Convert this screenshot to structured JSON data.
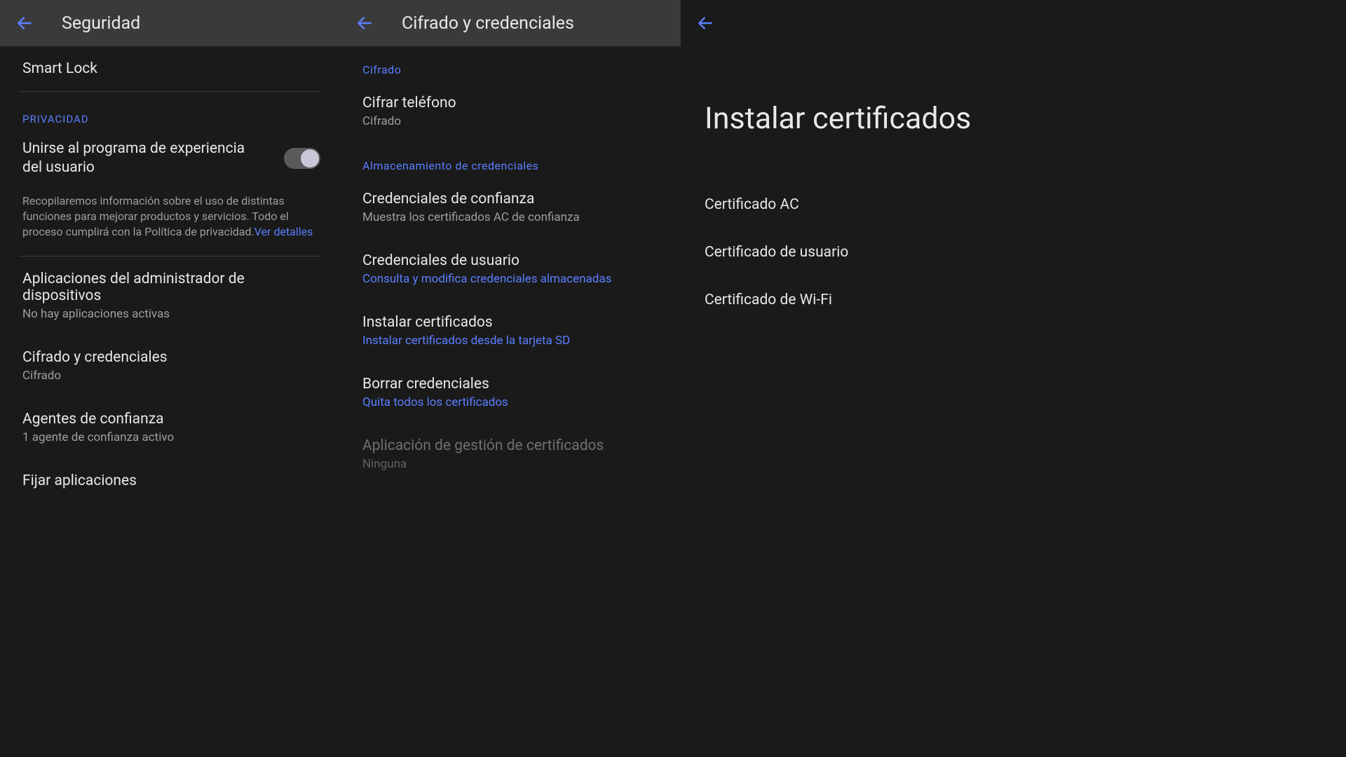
{
  "colors": {
    "accent": "#5a7fff",
    "bg": "#1a1a1a",
    "header_bg": "#3a3a3a"
  },
  "panel1": {
    "header_title": "Seguridad",
    "smart_lock": "Smart Lock",
    "privacy_header": "PRIVACIDAD",
    "ux_program_label": "Unirse al programa de experiencia del usuario",
    "ux_desc": "Recopilaremos información sobre el uso de distintas funciones para mejorar productos y servicios. Todo el proceso cumplirá con la Política de privacidad.",
    "ux_link": "Ver detalles",
    "admin_apps_title": "Aplicaciones del administrador de dispositivos",
    "admin_apps_sub": "No hay aplicaciones activas",
    "encrypt_creds_title": "Cifrado y credenciales",
    "encrypt_creds_sub": "Cifrado",
    "trust_agents_title": "Agentes de confianza",
    "trust_agents_sub": "1 agente de confianza activo",
    "pin_apps_title": "Fijar aplicaciones"
  },
  "panel2": {
    "header_title": "Cifrado y credenciales",
    "section_encrypt": "Cifrado",
    "encrypt_phone_title": "Cifrar teléfono",
    "encrypt_phone_sub": "Cifrado",
    "section_storage": "Almacenamiento de credenciales",
    "trusted_creds_title": "Credenciales de confianza",
    "trusted_creds_sub": "Muestra los certificados AC de confianza",
    "user_creds_title": "Credenciales de usuario",
    "user_creds_sub": "Consulta y modifica credenciales almacenadas",
    "install_certs_title": "Instalar certificados",
    "install_certs_sub": "Instalar certificados desde la tarjeta SD",
    "clear_creds_title": "Borrar credenciales",
    "clear_creds_sub": "Quita todos los certificados",
    "cert_mgmt_title": "Aplicación de gestión de certificados",
    "cert_mgmt_sub": "Ninguna"
  },
  "panel3": {
    "big_title": "Instalar certificados",
    "cert_ca": "Certificado AC",
    "cert_user": "Certificado de usuario",
    "cert_wifi": "Certificado de Wi-Fi"
  }
}
